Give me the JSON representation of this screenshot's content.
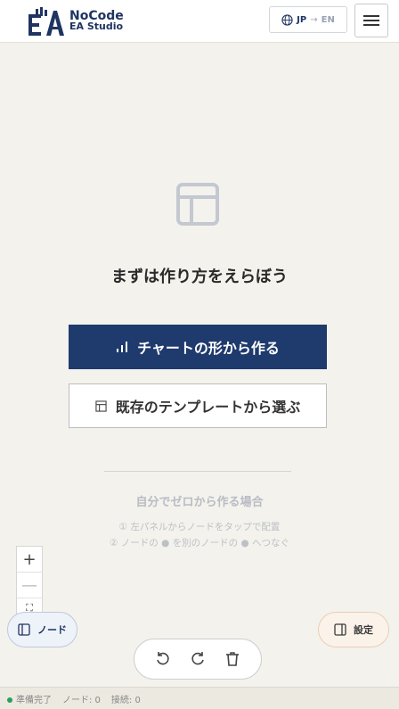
{
  "header": {
    "logo_line1": "NoCode",
    "logo_line2": "EA Studio",
    "lang_from": "JP",
    "lang_arrow": "→",
    "lang_to": "EN"
  },
  "empty_state": {
    "title": "まずは作り方をえらぼう",
    "primary_label": "チャートの形から作る",
    "secondary_label": "既存のテンプレートから選ぶ",
    "hint_title": "自分でゼロから作る場合",
    "hint_step1": "① 左パネルからノードをタップで配置",
    "hint_step2": "② ノードの ● を別のノードの ● へつなぐ"
  },
  "zoom": {
    "in": "+",
    "out": "—",
    "fit": "⛶"
  },
  "panels": {
    "node_label": "ノード",
    "settings_label": "設定"
  },
  "status": {
    "ready": "準備完了",
    "nodes": "ノード: 0",
    "connections": "接続: 0",
    "ready_color": "#2e9e5b"
  },
  "colors": {
    "brand": "#1f3a6d",
    "background": "#f4f2ec"
  }
}
